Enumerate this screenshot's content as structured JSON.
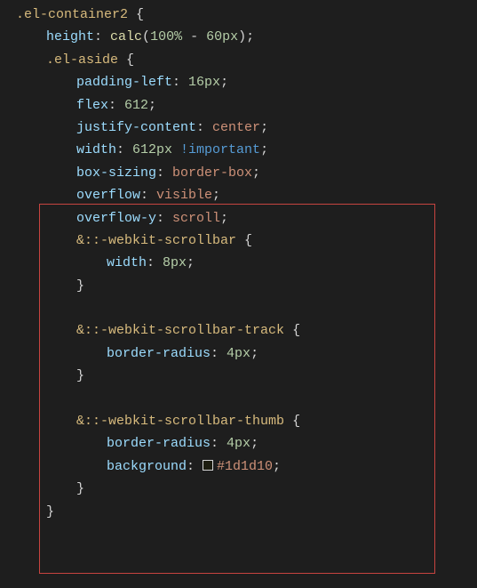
{
  "code": {
    "l1": {
      "sel": ".el-container2",
      "brace": " {"
    },
    "l2": {
      "prop": "height",
      "colon": ": ",
      "func": "calc",
      "open": "(",
      "n1": "100%",
      "op": " - ",
      "n2": "60px",
      "close": ")",
      "semi": ";"
    },
    "l3": {
      "sel": ".el-aside",
      "brace": " {"
    },
    "l4": {
      "prop": "padding-left",
      "colon": ": ",
      "val": "16px",
      "semi": ";"
    },
    "l5": {
      "prop": "flex",
      "colon": ": ",
      "val": "612",
      "semi": ";"
    },
    "l6": {
      "prop": "justify-content",
      "colon": ": ",
      "val": "center",
      "semi": ";"
    },
    "l7": {
      "prop": "width",
      "colon": ": ",
      "val": "612px",
      "imp": " !important",
      "semi": ";"
    },
    "l8": {
      "prop": "box-sizing",
      "colon": ": ",
      "val": "border-box",
      "semi": ";"
    },
    "l9": {
      "prop": "overflow",
      "colon": ": ",
      "val": "visible",
      "semi": ";"
    },
    "l10": {
      "prop": "overflow-y",
      "colon": ": ",
      "val": "scroll",
      "semi": ";"
    },
    "l11": {
      "amp": "&",
      "sel": "::-webkit-scrollbar",
      "brace": " {"
    },
    "l12": {
      "prop": "width",
      "colon": ": ",
      "val": "8px",
      "semi": ";"
    },
    "l13": {
      "brace": "}"
    },
    "l14": {
      "blank": ""
    },
    "l15": {
      "amp": "&",
      "sel": "::-webkit-scrollbar-track",
      "brace": " {"
    },
    "l16": {
      "prop": "border-radius",
      "colon": ": ",
      "val": "4px",
      "semi": ";"
    },
    "l17": {
      "brace": "}"
    },
    "l18": {
      "blank": ""
    },
    "l19": {
      "amp": "&",
      "sel": "::-webkit-scrollbar-thumb",
      "brace": " {"
    },
    "l20": {
      "prop": "border-radius",
      "colon": ": ",
      "val": "4px",
      "semi": ";"
    },
    "l21": {
      "prop": "background",
      "colon": ": ",
      "hex": "#1d1d10",
      "semi": ";"
    },
    "l22": {
      "brace": "}"
    },
    "l23": {
      "brace": "}"
    }
  }
}
